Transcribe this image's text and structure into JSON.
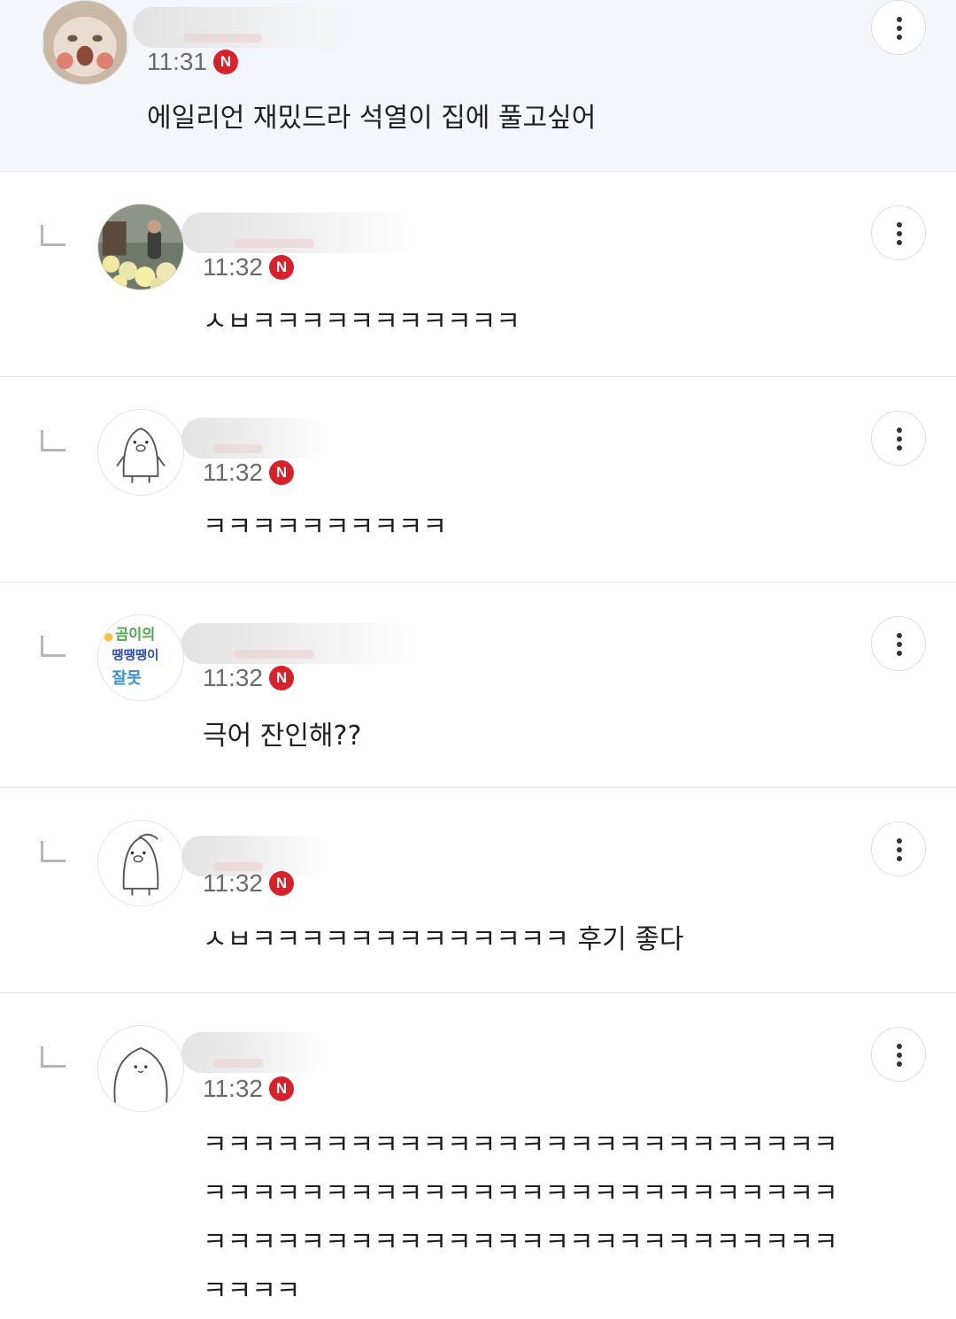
{
  "comments": [
    {
      "time": "11:31",
      "new_badge": "N",
      "text": "에일리언 재밌드라 석열이 집에 풀고싶어",
      "avatar": "cat-avatar"
    },
    {
      "time": "11:32",
      "new_badge": "N",
      "text": "ㅅㅂㅋㅋㅋㅋㅋㅋㅋㅋㅋㅋㅋ",
      "avatar": "flowers-photo-avatar"
    },
    {
      "time": "11:32",
      "new_badge": "N",
      "text": "ㅋㅋㅋㅋㅋㅋㅋㅋㅋㅋ",
      "avatar": "penguin-avatar"
    },
    {
      "time": "11:32",
      "new_badge": "N",
      "text": "극어 잔인해??",
      "avatar": "sticker-text-avatar",
      "avatar_text": [
        "곰이의",
        "땡땡땡이",
        "잘못"
      ]
    },
    {
      "time": "11:32",
      "new_badge": "N",
      "text": "ㅅㅂㅋㅋㅋㅋㅋㅋㅋㅋㅋㅋㅋㅋㅋ 후기 좋다",
      "avatar": "penguin-avatar"
    },
    {
      "time": "11:32",
      "new_badge": "N",
      "text": "ㅋㅋㅋㅋㅋㅋㅋㅋㅋㅋㅋㅋㅋㅋㅋㅋㅋㅋㅋㅋㅋㅋㅋㅋㅋㅋ\nㅋㅋㅋㅋㅋㅋㅋㅋㅋㅋㅋㅋㅋㅋㅋㅋㅋㅋㅋㅋㅋㅋㅋㅋㅋㅋ\nㅋㅋㅋㅋㅋㅋㅋㅋㅋㅋㅋㅋㅋㅋㅋㅋㅋㅋㅋㅋㅋㅋㅋㅋㅋㅋ\nㅋㅋㅋㅋ",
      "avatar": "seal-avatar"
    }
  ],
  "icons": {
    "more": "more-vertical-icon",
    "reply": "reply-arrow-icon"
  },
  "colors": {
    "top_background": "#f3f6fb",
    "new_badge": "#d9212b",
    "divider": "#e6e6e6"
  }
}
